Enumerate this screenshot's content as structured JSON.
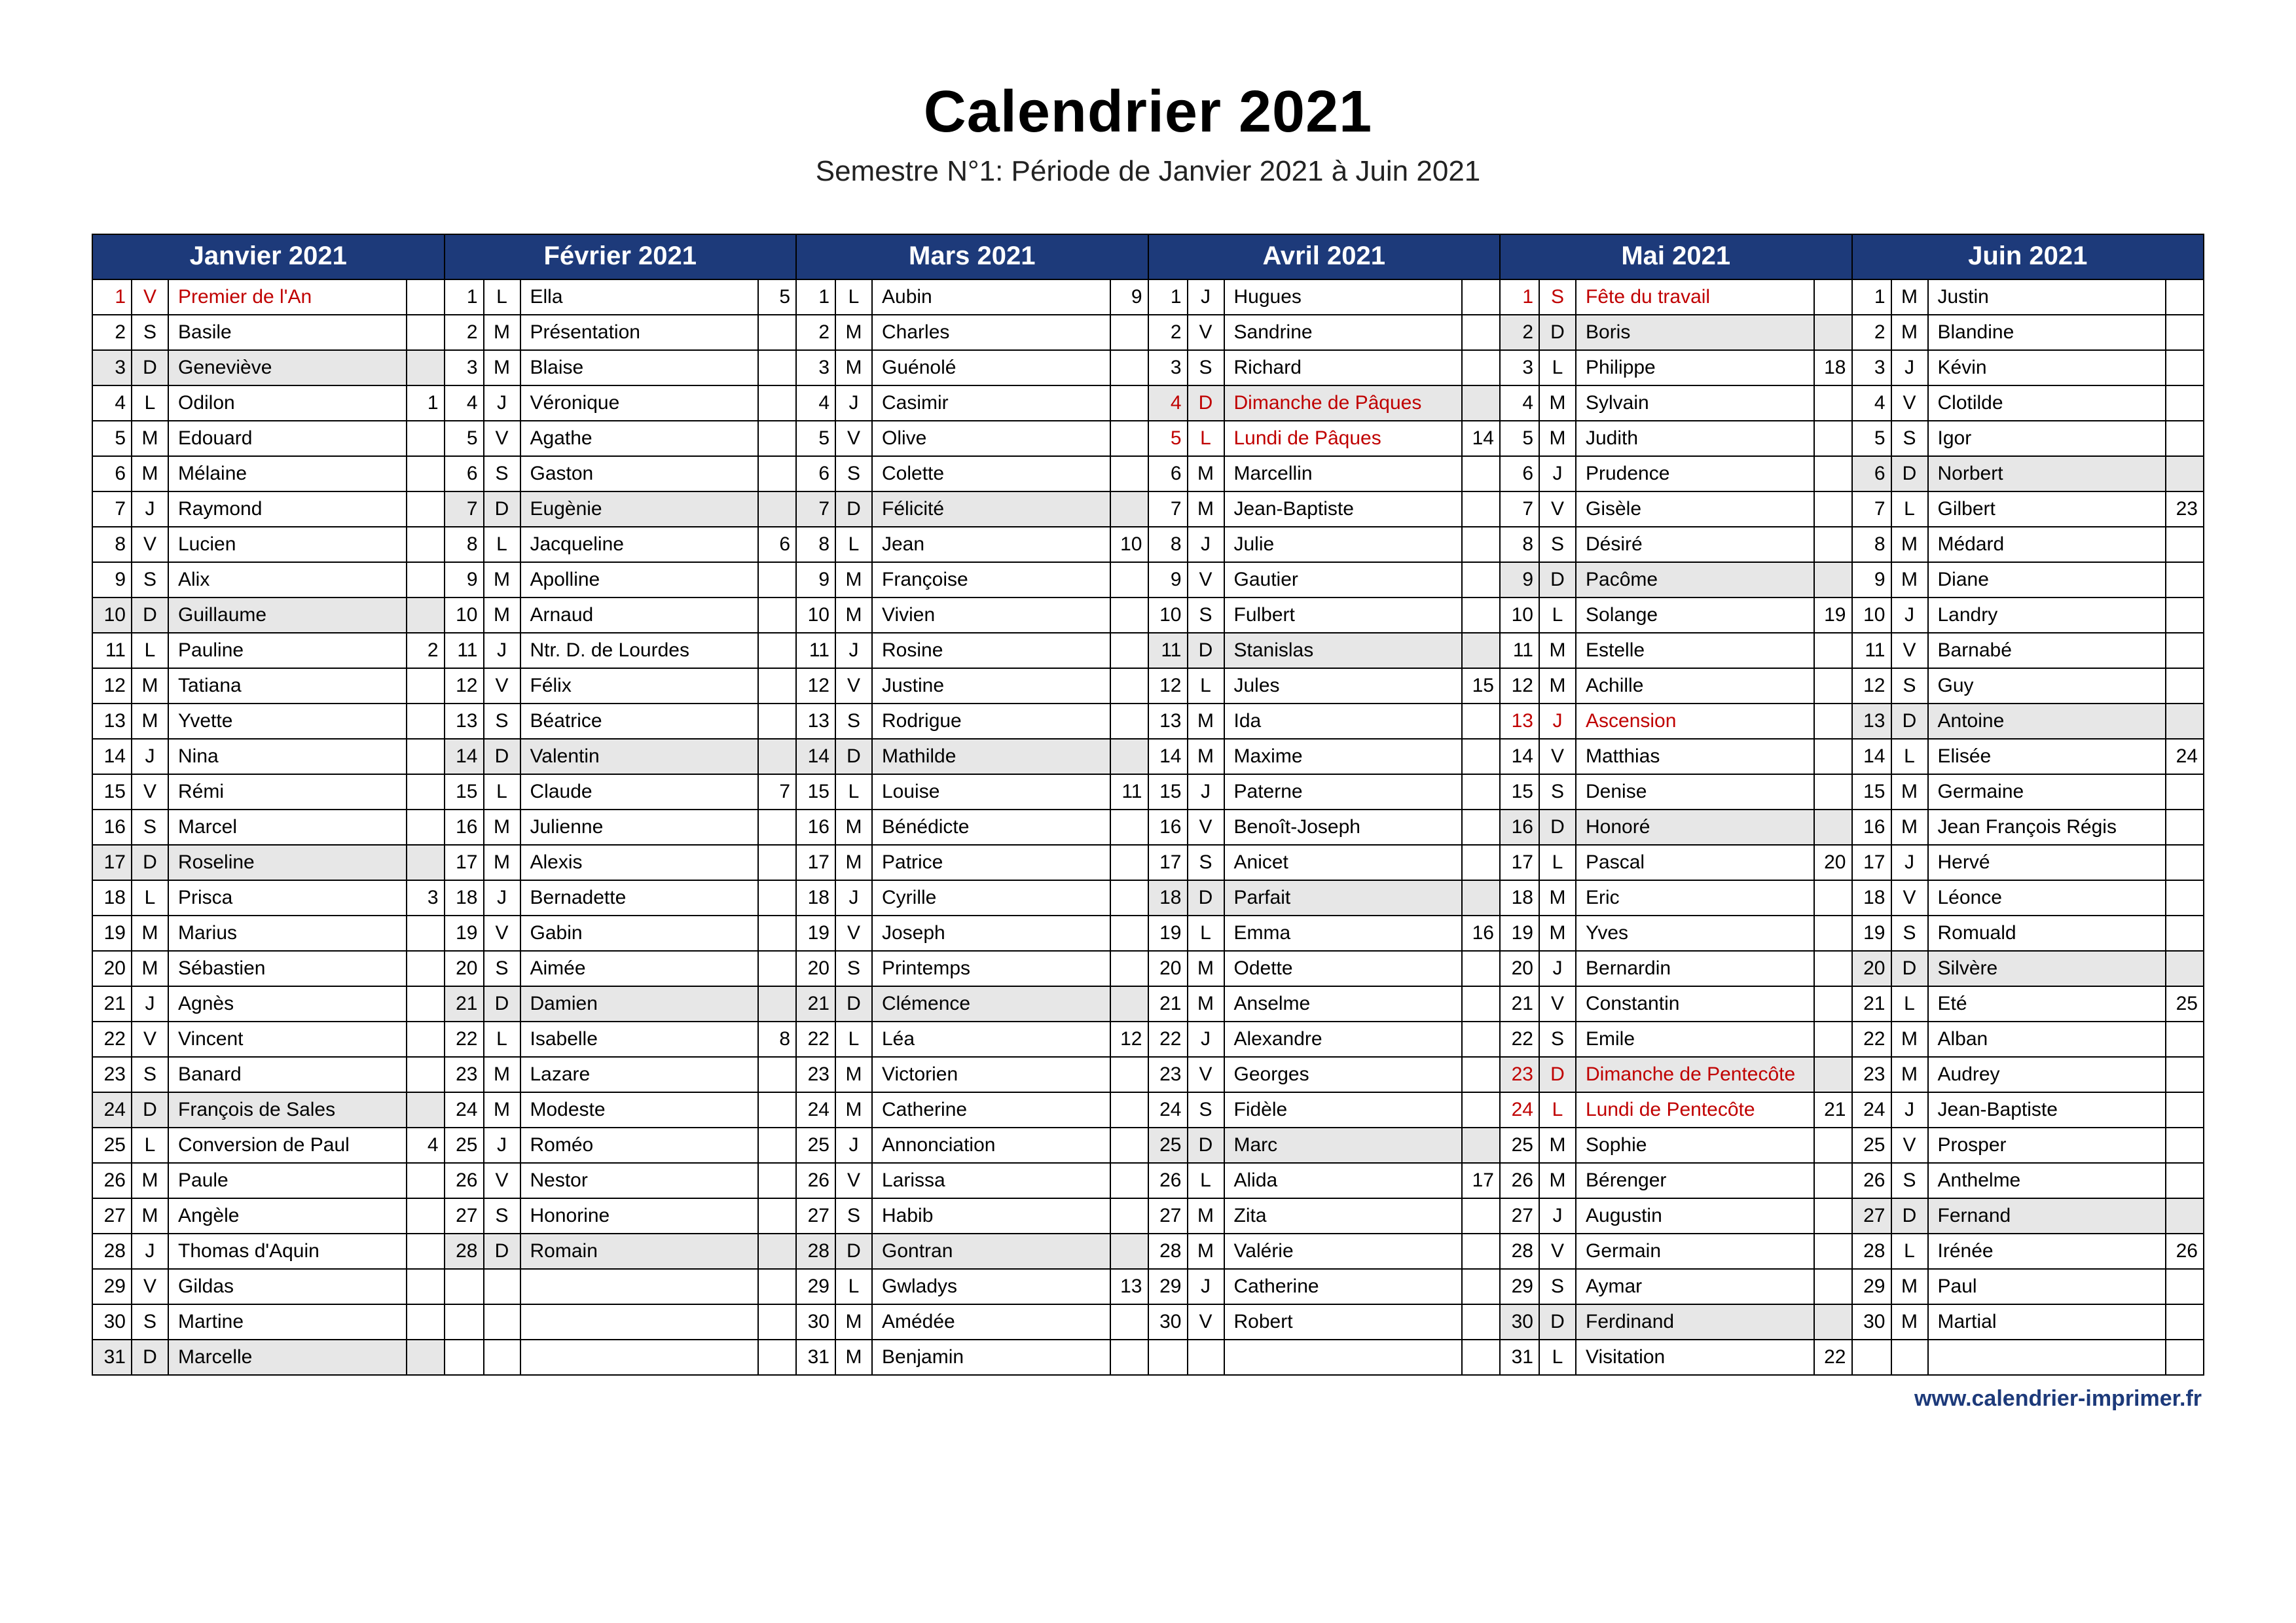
{
  "title": "Calendrier 2021",
  "subtitle": "Semestre N°1: Période de Janvier 2021 à Juin 2021",
  "footer": "www.calendrier-imprimer.fr",
  "months": [
    {
      "label": "Janvier 2021",
      "days": [
        {
          "n": 1,
          "d": "V",
          "name": "Premier de l'An",
          "holiday": true
        },
        {
          "n": 2,
          "d": "S",
          "name": "Basile"
        },
        {
          "n": 3,
          "d": "D",
          "name": "Geneviève",
          "sunday": true
        },
        {
          "n": 4,
          "d": "L",
          "name": "Odilon",
          "wk": 1
        },
        {
          "n": 5,
          "d": "M",
          "name": "Edouard"
        },
        {
          "n": 6,
          "d": "M",
          "name": "Mélaine"
        },
        {
          "n": 7,
          "d": "J",
          "name": "Raymond"
        },
        {
          "n": 8,
          "d": "V",
          "name": "Lucien"
        },
        {
          "n": 9,
          "d": "S",
          "name": "Alix"
        },
        {
          "n": 10,
          "d": "D",
          "name": "Guillaume",
          "sunday": true
        },
        {
          "n": 11,
          "d": "L",
          "name": "Pauline",
          "wk": 2
        },
        {
          "n": 12,
          "d": "M",
          "name": "Tatiana"
        },
        {
          "n": 13,
          "d": "M",
          "name": "Yvette"
        },
        {
          "n": 14,
          "d": "J",
          "name": "Nina"
        },
        {
          "n": 15,
          "d": "V",
          "name": "Rémi"
        },
        {
          "n": 16,
          "d": "S",
          "name": "Marcel"
        },
        {
          "n": 17,
          "d": "D",
          "name": "Roseline",
          "sunday": true
        },
        {
          "n": 18,
          "d": "L",
          "name": "Prisca",
          "wk": 3
        },
        {
          "n": 19,
          "d": "M",
          "name": "Marius"
        },
        {
          "n": 20,
          "d": "M",
          "name": "Sébastien"
        },
        {
          "n": 21,
          "d": "J",
          "name": "Agnès"
        },
        {
          "n": 22,
          "d": "V",
          "name": "Vincent"
        },
        {
          "n": 23,
          "d": "S",
          "name": "Banard"
        },
        {
          "n": 24,
          "d": "D",
          "name": "François de Sales",
          "sunday": true
        },
        {
          "n": 25,
          "d": "L",
          "name": "Conversion de Paul",
          "wk": 4
        },
        {
          "n": 26,
          "d": "M",
          "name": "Paule"
        },
        {
          "n": 27,
          "d": "M",
          "name": "Angèle"
        },
        {
          "n": 28,
          "d": "J",
          "name": "Thomas d'Aquin"
        },
        {
          "n": 29,
          "d": "V",
          "name": "Gildas"
        },
        {
          "n": 30,
          "d": "S",
          "name": "Martine"
        },
        {
          "n": 31,
          "d": "D",
          "name": "Marcelle",
          "sunday": true
        }
      ]
    },
    {
      "label": "Février 2021",
      "days": [
        {
          "n": 1,
          "d": "L",
          "name": "Ella",
          "wk": 5
        },
        {
          "n": 2,
          "d": "M",
          "name": "Présentation"
        },
        {
          "n": 3,
          "d": "M",
          "name": "Blaise"
        },
        {
          "n": 4,
          "d": "J",
          "name": "Véronique"
        },
        {
          "n": 5,
          "d": "V",
          "name": "Agathe"
        },
        {
          "n": 6,
          "d": "S",
          "name": "Gaston"
        },
        {
          "n": 7,
          "d": "D",
          "name": "Eugènie",
          "sunday": true
        },
        {
          "n": 8,
          "d": "L",
          "name": "Jacqueline",
          "wk": 6
        },
        {
          "n": 9,
          "d": "M",
          "name": "Apolline"
        },
        {
          "n": 10,
          "d": "M",
          "name": "Arnaud"
        },
        {
          "n": 11,
          "d": "J",
          "name": "Ntr. D. de Lourdes"
        },
        {
          "n": 12,
          "d": "V",
          "name": "Félix"
        },
        {
          "n": 13,
          "d": "S",
          "name": "Béatrice"
        },
        {
          "n": 14,
          "d": "D",
          "name": "Valentin",
          "sunday": true
        },
        {
          "n": 15,
          "d": "L",
          "name": "Claude",
          "wk": 7
        },
        {
          "n": 16,
          "d": "M",
          "name": "Julienne"
        },
        {
          "n": 17,
          "d": "M",
          "name": "Alexis"
        },
        {
          "n": 18,
          "d": "J",
          "name": "Bernadette"
        },
        {
          "n": 19,
          "d": "V",
          "name": "Gabin"
        },
        {
          "n": 20,
          "d": "S",
          "name": "Aimée"
        },
        {
          "n": 21,
          "d": "D",
          "name": "Damien",
          "sunday": true
        },
        {
          "n": 22,
          "d": "L",
          "name": "Isabelle",
          "wk": 8
        },
        {
          "n": 23,
          "d": "M",
          "name": "Lazare"
        },
        {
          "n": 24,
          "d": "M",
          "name": "Modeste"
        },
        {
          "n": 25,
          "d": "J",
          "name": "Roméo"
        },
        {
          "n": 26,
          "d": "V",
          "name": "Nestor"
        },
        {
          "n": 27,
          "d": "S",
          "name": "Honorine"
        },
        {
          "n": 28,
          "d": "D",
          "name": "Romain",
          "sunday": true
        },
        {
          "empty": true
        },
        {
          "empty": true
        },
        {
          "empty": true
        }
      ]
    },
    {
      "label": "Mars 2021",
      "days": [
        {
          "n": 1,
          "d": "L",
          "name": "Aubin",
          "wk": 9
        },
        {
          "n": 2,
          "d": "M",
          "name": "Charles"
        },
        {
          "n": 3,
          "d": "M",
          "name": "Guénolé"
        },
        {
          "n": 4,
          "d": "J",
          "name": "Casimir"
        },
        {
          "n": 5,
          "d": "V",
          "name": "Olive"
        },
        {
          "n": 6,
          "d": "S",
          "name": "Colette"
        },
        {
          "n": 7,
          "d": "D",
          "name": "Félicité",
          "sunday": true
        },
        {
          "n": 8,
          "d": "L",
          "name": "Jean",
          "wk": 10
        },
        {
          "n": 9,
          "d": "M",
          "name": "Françoise"
        },
        {
          "n": 10,
          "d": "M",
          "name": "Vivien"
        },
        {
          "n": 11,
          "d": "J",
          "name": "Rosine"
        },
        {
          "n": 12,
          "d": "V",
          "name": "Justine"
        },
        {
          "n": 13,
          "d": "S",
          "name": "Rodrigue"
        },
        {
          "n": 14,
          "d": "D",
          "name": "Mathilde",
          "sunday": true
        },
        {
          "n": 15,
          "d": "L",
          "name": "Louise",
          "wk": 11
        },
        {
          "n": 16,
          "d": "M",
          "name": "Bénédicte"
        },
        {
          "n": 17,
          "d": "M",
          "name": "Patrice"
        },
        {
          "n": 18,
          "d": "J",
          "name": "Cyrille"
        },
        {
          "n": 19,
          "d": "V",
          "name": "Joseph"
        },
        {
          "n": 20,
          "d": "S",
          "name": "Printemps"
        },
        {
          "n": 21,
          "d": "D",
          "name": "Clémence",
          "sunday": true
        },
        {
          "n": 22,
          "d": "L",
          "name": "Léa",
          "wk": 12
        },
        {
          "n": 23,
          "d": "M",
          "name": "Victorien"
        },
        {
          "n": 24,
          "d": "M",
          "name": "Catherine"
        },
        {
          "n": 25,
          "d": "J",
          "name": "Annonciation"
        },
        {
          "n": 26,
          "d": "V",
          "name": "Larissa"
        },
        {
          "n": 27,
          "d": "S",
          "name": "Habib"
        },
        {
          "n": 28,
          "d": "D",
          "name": "Gontran",
          "sunday": true
        },
        {
          "n": 29,
          "d": "L",
          "name": "Gwladys",
          "wk": 13
        },
        {
          "n": 30,
          "d": "M",
          "name": "Amédée"
        },
        {
          "n": 31,
          "d": "M",
          "name": "Benjamin"
        }
      ]
    },
    {
      "label": "Avril 2021",
      "days": [
        {
          "n": 1,
          "d": "J",
          "name": "Hugues"
        },
        {
          "n": 2,
          "d": "V",
          "name": "Sandrine"
        },
        {
          "n": 3,
          "d": "S",
          "name": "Richard"
        },
        {
          "n": 4,
          "d": "D",
          "name": "Dimanche de Pâques",
          "sunday": true,
          "holiday": true
        },
        {
          "n": 5,
          "d": "L",
          "name": "Lundi de Pâques",
          "wk": 14,
          "holiday": true
        },
        {
          "n": 6,
          "d": "M",
          "name": "Marcellin"
        },
        {
          "n": 7,
          "d": "M",
          "name": "Jean-Baptiste"
        },
        {
          "n": 8,
          "d": "J",
          "name": "Julie"
        },
        {
          "n": 9,
          "d": "V",
          "name": "Gautier"
        },
        {
          "n": 10,
          "d": "S",
          "name": "Fulbert"
        },
        {
          "n": 11,
          "d": "D",
          "name": "Stanislas",
          "sunday": true
        },
        {
          "n": 12,
          "d": "L",
          "name": "Jules",
          "wk": 15
        },
        {
          "n": 13,
          "d": "M",
          "name": "Ida"
        },
        {
          "n": 14,
          "d": "M",
          "name": "Maxime"
        },
        {
          "n": 15,
          "d": "J",
          "name": "Paterne"
        },
        {
          "n": 16,
          "d": "V",
          "name": "Benoît-Joseph"
        },
        {
          "n": 17,
          "d": "S",
          "name": "Anicet"
        },
        {
          "n": 18,
          "d": "D",
          "name": "Parfait",
          "sunday": true
        },
        {
          "n": 19,
          "d": "L",
          "name": "Emma",
          "wk": 16
        },
        {
          "n": 20,
          "d": "M",
          "name": "Odette"
        },
        {
          "n": 21,
          "d": "M",
          "name": "Anselme"
        },
        {
          "n": 22,
          "d": "J",
          "name": "Alexandre"
        },
        {
          "n": 23,
          "d": "V",
          "name": "Georges"
        },
        {
          "n": 24,
          "d": "S",
          "name": "Fidèle"
        },
        {
          "n": 25,
          "d": "D",
          "name": "Marc",
          "sunday": true
        },
        {
          "n": 26,
          "d": "L",
          "name": "Alida",
          "wk": 17
        },
        {
          "n": 27,
          "d": "M",
          "name": "Zita"
        },
        {
          "n": 28,
          "d": "M",
          "name": "Valérie"
        },
        {
          "n": 29,
          "d": "J",
          "name": "Catherine"
        },
        {
          "n": 30,
          "d": "V",
          "name": "Robert"
        },
        {
          "empty": true
        }
      ]
    },
    {
      "label": "Mai 2021",
      "days": [
        {
          "n": 1,
          "d": "S",
          "name": "Fête du travail",
          "holiday": true
        },
        {
          "n": 2,
          "d": "D",
          "name": "Boris",
          "sunday": true
        },
        {
          "n": 3,
          "d": "L",
          "name": "Philippe",
          "wk": 18
        },
        {
          "n": 4,
          "d": "M",
          "name": "Sylvain"
        },
        {
          "n": 5,
          "d": "M",
          "name": "Judith"
        },
        {
          "n": 6,
          "d": "J",
          "name": "Prudence"
        },
        {
          "n": 7,
          "d": "V",
          "name": "Gisèle"
        },
        {
          "n": 8,
          "d": "S",
          "name": "Désiré"
        },
        {
          "n": 9,
          "d": "D",
          "name": "Pacôme",
          "sunday": true
        },
        {
          "n": 10,
          "d": "L",
          "name": "Solange",
          "wk": 19
        },
        {
          "n": 11,
          "d": "M",
          "name": "Estelle"
        },
        {
          "n": 12,
          "d": "M",
          "name": "Achille"
        },
        {
          "n": 13,
          "d": "J",
          "name": "Ascension",
          "holiday": true
        },
        {
          "n": 14,
          "d": "V",
          "name": "Matthias"
        },
        {
          "n": 15,
          "d": "S",
          "name": "Denise"
        },
        {
          "n": 16,
          "d": "D",
          "name": "Honoré",
          "sunday": true
        },
        {
          "n": 17,
          "d": "L",
          "name": "Pascal",
          "wk": 20
        },
        {
          "n": 18,
          "d": "M",
          "name": "Eric"
        },
        {
          "n": 19,
          "d": "M",
          "name": "Yves"
        },
        {
          "n": 20,
          "d": "J",
          "name": "Bernardin"
        },
        {
          "n": 21,
          "d": "V",
          "name": "Constantin"
        },
        {
          "n": 22,
          "d": "S",
          "name": "Emile"
        },
        {
          "n": 23,
          "d": "D",
          "name": "Dimanche de Pentecôte",
          "sunday": true,
          "holiday": true
        },
        {
          "n": 24,
          "d": "L",
          "name": "Lundi de Pentecôte",
          "wk": 21,
          "holiday": true
        },
        {
          "n": 25,
          "d": "M",
          "name": "Sophie"
        },
        {
          "n": 26,
          "d": "M",
          "name": "Bérenger"
        },
        {
          "n": 27,
          "d": "J",
          "name": "Augustin"
        },
        {
          "n": 28,
          "d": "V",
          "name": "Germain"
        },
        {
          "n": 29,
          "d": "S",
          "name": "Aymar"
        },
        {
          "n": 30,
          "d": "D",
          "name": "Ferdinand",
          "sunday": true
        },
        {
          "n": 31,
          "d": "L",
          "name": "Visitation",
          "wk": 22
        }
      ]
    },
    {
      "label": "Juin 2021",
      "days": [
        {
          "n": 1,
          "d": "M",
          "name": "Justin"
        },
        {
          "n": 2,
          "d": "M",
          "name": "Blandine"
        },
        {
          "n": 3,
          "d": "J",
          "name": "Kévin"
        },
        {
          "n": 4,
          "d": "V",
          "name": "Clotilde"
        },
        {
          "n": 5,
          "d": "S",
          "name": "Igor"
        },
        {
          "n": 6,
          "d": "D",
          "name": "Norbert",
          "sunday": true
        },
        {
          "n": 7,
          "d": "L",
          "name": "Gilbert",
          "wk": 23
        },
        {
          "n": 8,
          "d": "M",
          "name": "Médard"
        },
        {
          "n": 9,
          "d": "M",
          "name": "Diane"
        },
        {
          "n": 10,
          "d": "J",
          "name": "Landry"
        },
        {
          "n": 11,
          "d": "V",
          "name": "Barnabé"
        },
        {
          "n": 12,
          "d": "S",
          "name": "Guy"
        },
        {
          "n": 13,
          "d": "D",
          "name": "Antoine",
          "sunday": true
        },
        {
          "n": 14,
          "d": "L",
          "name": "Elisée",
          "wk": 24
        },
        {
          "n": 15,
          "d": "M",
          "name": "Germaine"
        },
        {
          "n": 16,
          "d": "M",
          "name": "Jean François Régis"
        },
        {
          "n": 17,
          "d": "J",
          "name": "Hervé"
        },
        {
          "n": 18,
          "d": "V",
          "name": "Léonce"
        },
        {
          "n": 19,
          "d": "S",
          "name": "Romuald"
        },
        {
          "n": 20,
          "d": "D",
          "name": "Silvère",
          "sunday": true
        },
        {
          "n": 21,
          "d": "L",
          "name": "Eté",
          "wk": 25
        },
        {
          "n": 22,
          "d": "M",
          "name": "Alban"
        },
        {
          "n": 23,
          "d": "M",
          "name": "Audrey"
        },
        {
          "n": 24,
          "d": "J",
          "name": "Jean-Baptiste"
        },
        {
          "n": 25,
          "d": "V",
          "name": "Prosper"
        },
        {
          "n": 26,
          "d": "S",
          "name": "Anthelme"
        },
        {
          "n": 27,
          "d": "D",
          "name": "Fernand",
          "sunday": true
        },
        {
          "n": 28,
          "d": "L",
          "name": "Irénée",
          "wk": 26
        },
        {
          "n": 29,
          "d": "M",
          "name": "Paul"
        },
        {
          "n": 30,
          "d": "M",
          "name": "Martial"
        },
        {
          "empty": true
        }
      ]
    }
  ]
}
